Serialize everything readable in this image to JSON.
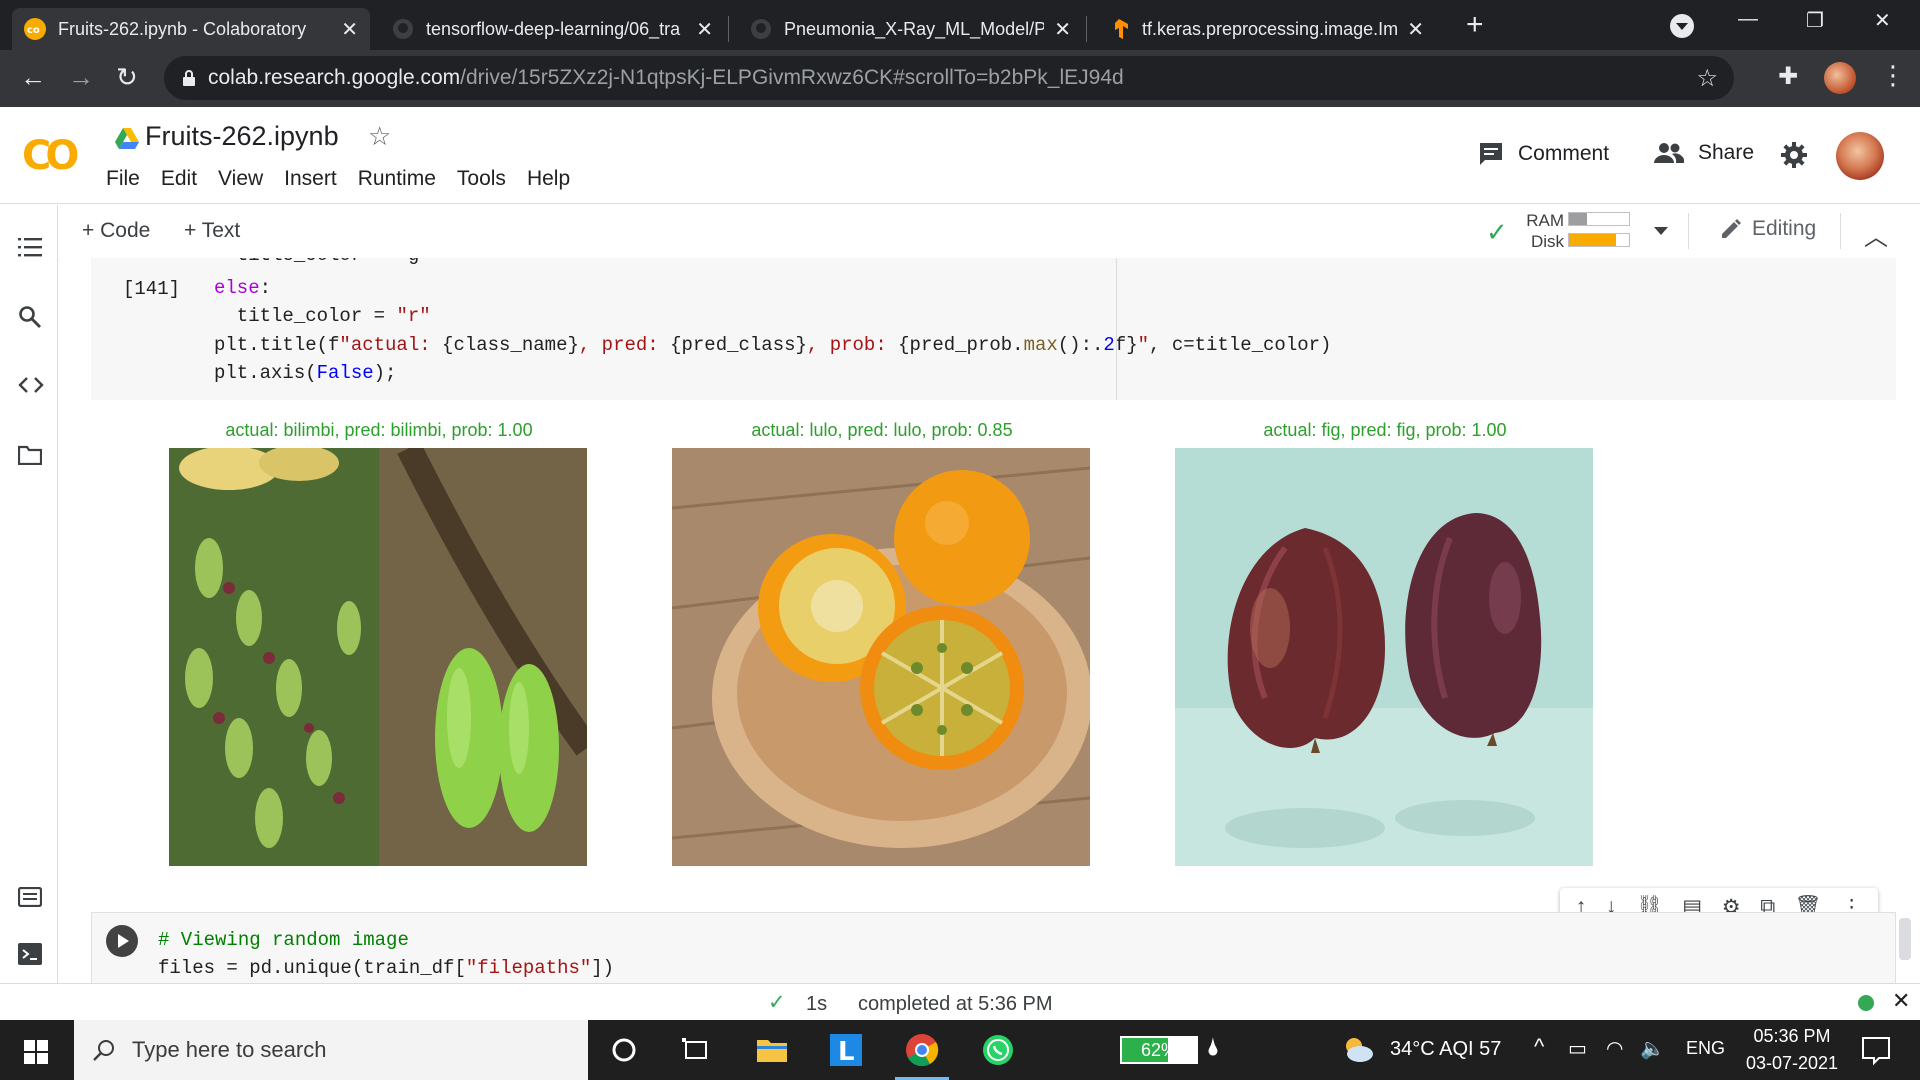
{
  "browser": {
    "tabs": [
      {
        "title": "Fruits-262.ipynb - Colaboratory",
        "active": true
      },
      {
        "title": "tensorflow-deep-learning/06_tra",
        "active": false
      },
      {
        "title": "Pneumonia_X-Ray_ML_Model/Pr",
        "active": false
      },
      {
        "title": "tf.keras.preprocessing.image.Ima",
        "active": false
      }
    ],
    "url_host": "colab.research.google.com",
    "url_path": "/drive/15r5ZXz2j-N1qtpsKj-ELPGivmRxwz6CK#scrollTo=b2bPk_lEJ94d"
  },
  "colab": {
    "logo": "CO",
    "notebook_title": "Fruits-262.ipynb",
    "menu": [
      "File",
      "Edit",
      "View",
      "Insert",
      "Runtime",
      "Tools",
      "Help"
    ],
    "comment_label": "Comment",
    "share_label": "Share",
    "add_code_label": "Code",
    "add_text_label": "Text",
    "ram_label": "RAM",
    "disk_label": "Disk",
    "ram_usage": 0.3,
    "disk_usage": 0.78,
    "editing_label": "Editing"
  },
  "cell1": {
    "exec_count": "[141]",
    "line0": "  title_color = \"g\"",
    "line1_kw": "else",
    "line1_rest": ":",
    "line2_a": "  title_color = ",
    "line2_str": "\"r\"",
    "line3_a": "plt.title(f",
    "line3_str1": "\"actual: ",
    "line3_b": "{class_name}",
    "line3_str2": ", pred: ",
    "line3_c": "{pred_class}",
    "line3_str3": ", prob: ",
    "line3_d": "{pred_prob.",
    "line3_fn": "max",
    "line3_e": "():.",
    "line3_num": "2",
    "line3_f": "f}",
    "line3_str4": "\"",
    "line3_g": ", c=title_color)",
    "line4_a": "plt.axis(",
    "line4_const": "False",
    "line4_b": ");"
  },
  "plots": [
    {
      "title": "actual: bilimbi, pred: bilimbi, prob: 1.00"
    },
    {
      "title": "actual: lulo, pred: lulo, prob: 0.85"
    },
    {
      "title": "actual: fig, pred: fig, prob: 1.00"
    }
  ],
  "cell2": {
    "comment": "# Viewing random image",
    "line2_a": "files = pd.unique(train_df[",
    "line2_str": "\"filepaths\"",
    "line2_b": "])"
  },
  "status": {
    "duration": "1s",
    "text": "completed at 5:36 PM"
  },
  "taskbar": {
    "search_placeholder": "Type here to search",
    "battery": "62%",
    "battery_level": 0.62,
    "weather": "34°C  AQI 57",
    "lang": "ENG",
    "time": "05:36 PM",
    "date": "03-07-2021"
  },
  "colors": {
    "title_green": "#2ca02c",
    "colab_orange": "#f9ab00",
    "ram_fill": "#9e9e9e",
    "disk_fill": "#f9ab00"
  }
}
